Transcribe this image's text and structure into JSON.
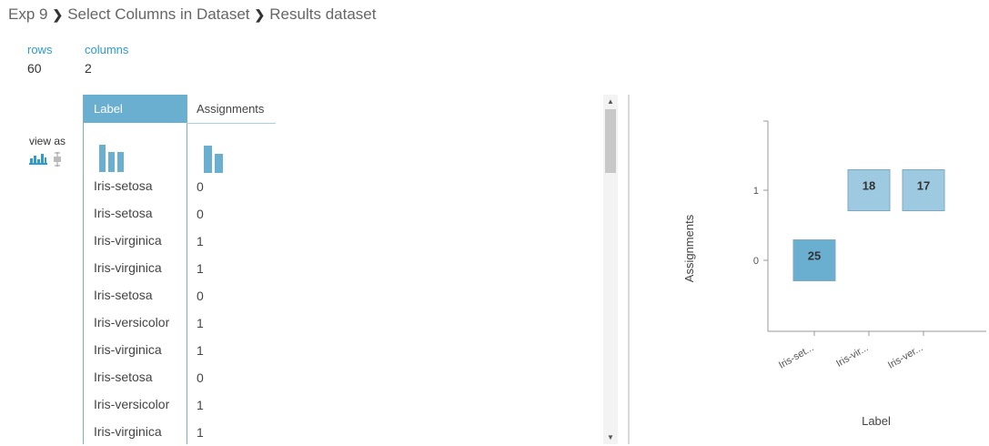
{
  "breadcrumb": {
    "items": [
      "Exp 9",
      "Select Columns in Dataset",
      "Results dataset"
    ]
  },
  "stats": {
    "rows_label": "rows",
    "rows_value": "60",
    "columns_label": "columns",
    "columns_value": "2"
  },
  "view_as": {
    "label": "view as",
    "icons": [
      "histogram-icon",
      "boxplot-icon"
    ]
  },
  "table": {
    "columns": [
      {
        "header": "Label",
        "selected": true,
        "mini_histogram": [
          3,
          2,
          2
        ]
      },
      {
        "header": "Assignments",
        "selected": false,
        "mini_histogram": [
          3,
          2
        ]
      }
    ],
    "rows": [
      [
        "Iris-setosa",
        "0"
      ],
      [
        "Iris-setosa",
        "0"
      ],
      [
        "Iris-virginica",
        "1"
      ],
      [
        "Iris-virginica",
        "1"
      ],
      [
        "Iris-setosa",
        "0"
      ],
      [
        "Iris-versicolor",
        "1"
      ],
      [
        "Iris-virginica",
        "1"
      ],
      [
        "Iris-setosa",
        "0"
      ],
      [
        "Iris-versicolor",
        "1"
      ],
      [
        "Iris-virginica",
        "1"
      ]
    ]
  },
  "colors": {
    "accent": "#6aaed0",
    "heat_dark": "#6aaed0",
    "heat_light": "#9ecae1",
    "link": "#2e9bd1"
  },
  "chart_data": {
    "type": "heatmap",
    "x_categories": [
      "Iris-set...",
      "Iris-vir...",
      "Iris-ver..."
    ],
    "y_categories": [
      "0",
      "1"
    ],
    "cells": [
      {
        "x": "Iris-set...",
        "y": "0",
        "value": 25
      },
      {
        "x": "Iris-vir...",
        "y": "1",
        "value": 18
      },
      {
        "x": "Iris-ver...",
        "y": "1",
        "value": 17
      }
    ],
    "xlabel": "Label",
    "ylabel": "Assignments",
    "title": "",
    "grid": false
  }
}
